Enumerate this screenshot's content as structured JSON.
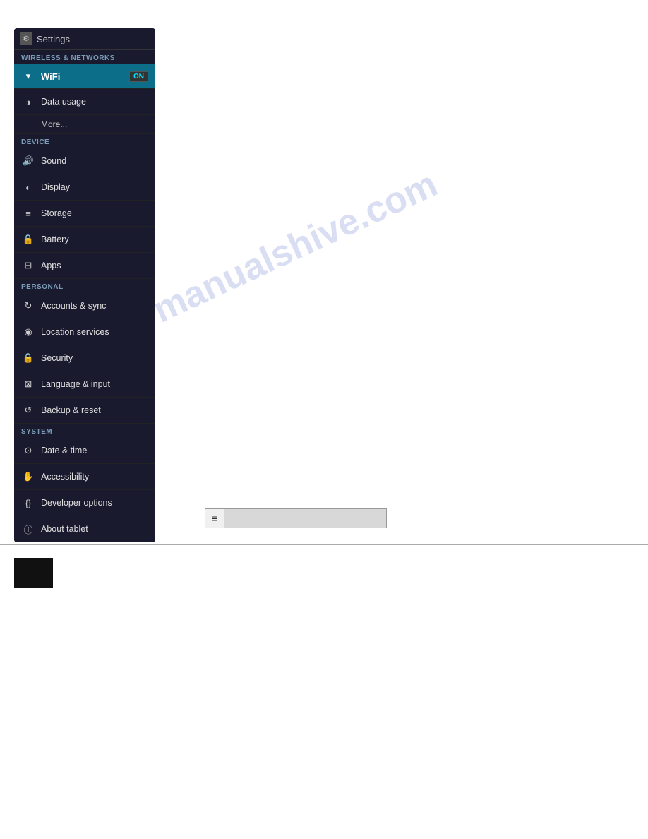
{
  "settings": {
    "title": "Settings",
    "sections": {
      "wireless": {
        "label": "WIRELESS & NETWORKS",
        "items": [
          {
            "id": "wifi",
            "label": "WiFi",
            "icon": "wifi",
            "active": true,
            "toggle": "ON"
          },
          {
            "id": "data-usage",
            "label": "Data usage",
            "icon": "data"
          },
          {
            "id": "more",
            "label": "More..."
          }
        ]
      },
      "device": {
        "label": "DEVICE",
        "items": [
          {
            "id": "sound",
            "label": "Sound",
            "icon": "sound"
          },
          {
            "id": "display",
            "label": "Display",
            "icon": "display"
          },
          {
            "id": "storage",
            "label": "Storage",
            "icon": "storage"
          },
          {
            "id": "battery",
            "label": "Battery",
            "icon": "battery"
          },
          {
            "id": "apps",
            "label": "Apps",
            "icon": "apps"
          }
        ]
      },
      "personal": {
        "label": "PERSONAL",
        "items": [
          {
            "id": "accounts-sync",
            "label": "Accounts & sync",
            "icon": "sync"
          },
          {
            "id": "location",
            "label": "Location services",
            "icon": "location"
          },
          {
            "id": "security",
            "label": "Security",
            "icon": "security"
          },
          {
            "id": "language",
            "label": "Language & input",
            "icon": "language"
          },
          {
            "id": "backup",
            "label": "Backup & reset",
            "icon": "backup"
          }
        ]
      },
      "system": {
        "label": "SYSTEM",
        "items": [
          {
            "id": "datetime",
            "label": "Date & time",
            "icon": "clock"
          },
          {
            "id": "accessibility",
            "label": "Accessibility",
            "icon": "accessibility"
          },
          {
            "id": "developer",
            "label": "Developer options",
            "icon": "developer"
          },
          {
            "id": "about",
            "label": "About tablet",
            "icon": "info"
          }
        ]
      }
    }
  },
  "watermark": {
    "text": "manualshive.com"
  },
  "search": {
    "placeholder": ""
  },
  "icons": {
    "wifi": "▾",
    "data": "◑",
    "sound": "🔊",
    "display": "◐",
    "storage": "≡",
    "battery": "🔒",
    "apps": "⊟",
    "sync": "↻",
    "location": "◉",
    "security": "🔒",
    "language": "⊠",
    "backup": "↺",
    "clock": "⊙",
    "accessibility": "✋",
    "developer": "{}",
    "info": "ⓘ"
  }
}
